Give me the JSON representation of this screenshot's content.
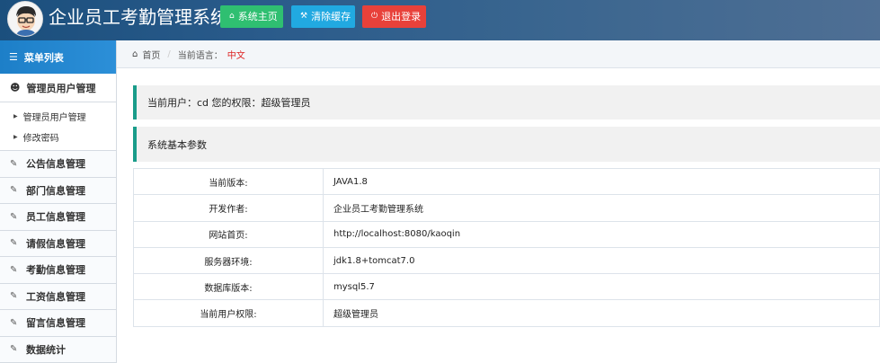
{
  "header": {
    "title": "企业员工考勤管理系统",
    "buttons": {
      "home": "系统主页",
      "clear_cache": "清除缓存",
      "logout": "退出登录"
    },
    "colors": {
      "green": "#2fbf71",
      "blue": "#21a9e1",
      "red": "#e8413a"
    }
  },
  "sidebar": {
    "heading": "菜单列表",
    "admin_group": "管理员用户管理",
    "admin_sub": [
      "管理员用户管理",
      "修改密码"
    ],
    "items": [
      "公告信息管理",
      "部门信息管理",
      "员工信息管理",
      "请假信息管理",
      "考勤信息管理",
      "工资信息管理",
      "留言信息管理",
      "数据统计"
    ]
  },
  "breadcrumb": {
    "home": "首页",
    "current_label": "当前语言：",
    "current_value": "中文"
  },
  "panels": {
    "user_info": "当前用户：cd 您的权限：超级管理员",
    "params_title": "系统基本参数"
  },
  "params": [
    {
      "key": "当前版本:",
      "value": "JAVA1.8"
    },
    {
      "key": "开发作者:",
      "value": "企业员工考勤管理系统"
    },
    {
      "key": "网站首页:",
      "value": "http://localhost:8080/kaoqin"
    },
    {
      "key": "服务器环境:",
      "value": "jdk1.8+tomcat7.0"
    },
    {
      "key": "数据库版本:",
      "value": "mysql5.7"
    },
    {
      "key": "当前用户权限:",
      "value": "超级管理员"
    }
  ]
}
